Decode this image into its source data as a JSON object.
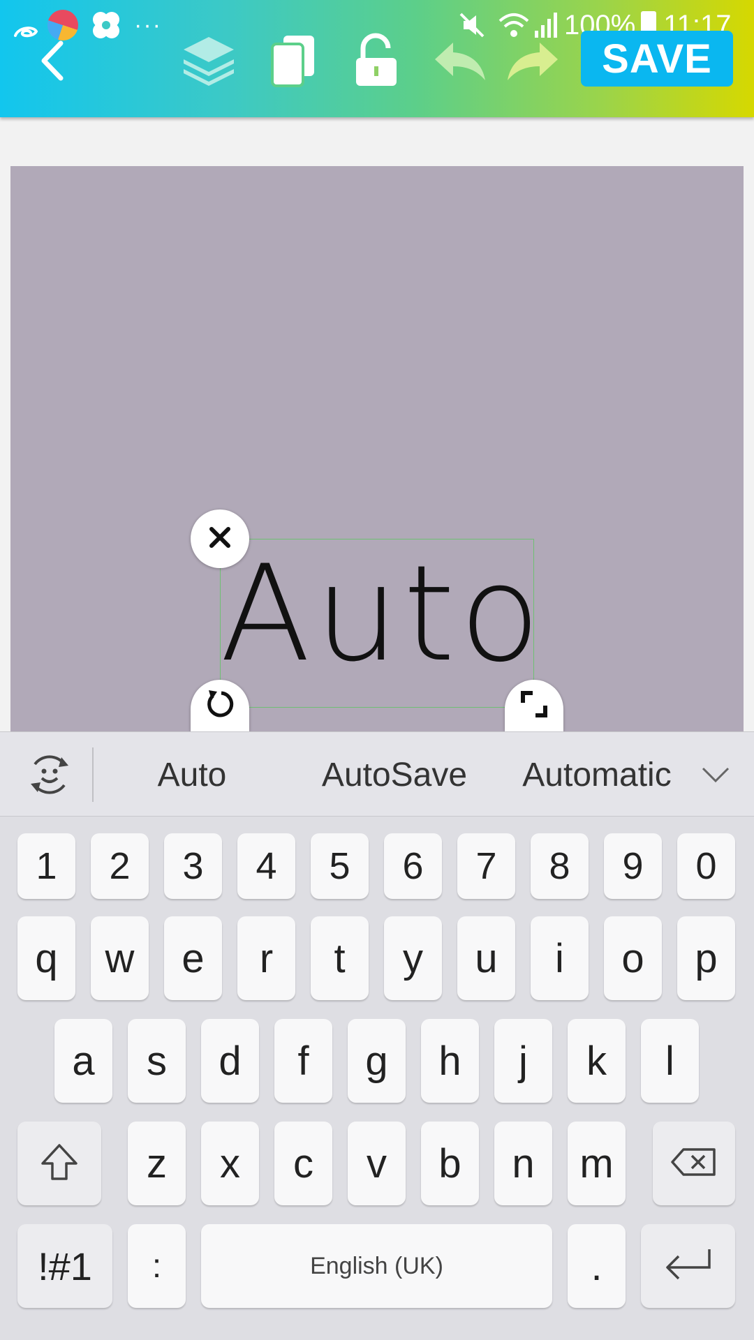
{
  "status_bar": {
    "battery": "100%",
    "time": "11:17"
  },
  "toolbar": {
    "save_label": "SAVE",
    "icons": [
      "back-icon",
      "layers-icon",
      "duplicate-icon",
      "unlock-icon",
      "undo-icon",
      "redo-icon"
    ]
  },
  "canvas": {
    "background_color": "#b1a9b8",
    "text_element": "Auto"
  },
  "keyboard": {
    "suggestions": [
      "Auto",
      "AutoSave",
      "Automatic"
    ],
    "number_row": [
      "1",
      "2",
      "3",
      "4",
      "5",
      "6",
      "7",
      "8",
      "9",
      "0"
    ],
    "row1": [
      "q",
      "w",
      "e",
      "r",
      "t",
      "y",
      "u",
      "i",
      "o",
      "p"
    ],
    "row2": [
      "a",
      "s",
      "d",
      "f",
      "g",
      "h",
      "j",
      "k",
      "l"
    ],
    "row3": [
      "z",
      "x",
      "c",
      "v",
      "b",
      "n",
      "m"
    ],
    "bottom": {
      "symbols": "!#1",
      "colon": ":",
      "space": "English (UK)",
      "period": "."
    }
  },
  "colors": {
    "accent": "#0ab7f0",
    "selection_border": "#6fbf73"
  }
}
